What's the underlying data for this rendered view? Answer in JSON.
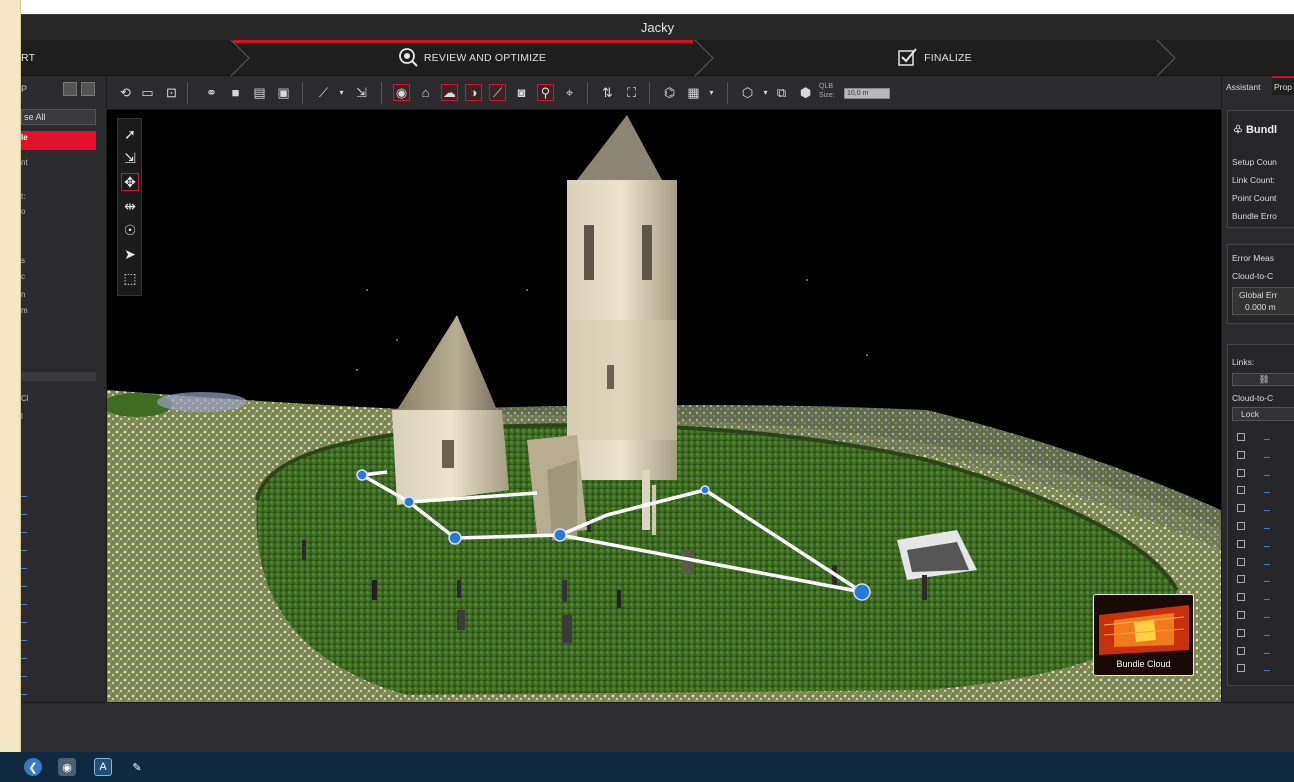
{
  "window": {
    "title": "Jacky"
  },
  "workflow": {
    "steps": [
      {
        "label": "RT",
        "state": "done"
      },
      {
        "label": "REVIEW AND OPTIMIZE",
        "state": "active"
      },
      {
        "label": "FINALIZE",
        "state": "pending"
      }
    ],
    "accent": "#d6102b"
  },
  "left_panel": {
    "header_label": "P",
    "collapse_label": "se All",
    "fragments": [
      "le",
      "nt",
      "t:",
      "o",
      "s",
      "c",
      "n",
      "m",
      "Cl",
      "l"
    ]
  },
  "toolbar": {
    "qlb_label": "QLB",
    "size_label": "Size:",
    "size_value": "10,0 m"
  },
  "viewport": {
    "thumbnail_label": "Bundle Cloud"
  },
  "right_panel": {
    "tabs": [
      "Assistant",
      "Prop"
    ],
    "bundle": {
      "title": "Bundl",
      "rows": [
        "Setup Coun",
        "Link Count:",
        "Point Count",
        "Bundle Erro"
      ]
    },
    "error": {
      "rows": [
        "Error Meas",
        "Cloud-to-C"
      ],
      "global_label": "Global Err",
      "global_value": "0.000 m"
    },
    "links": {
      "label": "Links:",
      "cloud_label": "Cloud-to-C",
      "lock_header": "Lock",
      "row_count": 14
    }
  },
  "taskbar": {
    "icons": [
      "windows-icon",
      "app-icon",
      "text-icon",
      "paint-icon"
    ]
  }
}
